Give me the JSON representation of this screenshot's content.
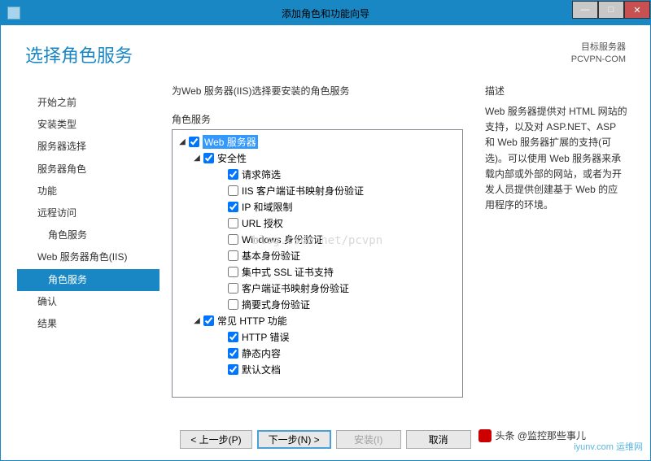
{
  "titlebar": {
    "title": "添加角色和功能向导"
  },
  "header": {
    "page_title": "选择角色服务",
    "target_label": "目标服务器",
    "target_name": "PCVPN-COM"
  },
  "sidebar": {
    "items": [
      {
        "label": "开始之前",
        "indent": 0,
        "active": false
      },
      {
        "label": "安装类型",
        "indent": 0,
        "active": false
      },
      {
        "label": "服务器选择",
        "indent": 0,
        "active": false
      },
      {
        "label": "服务器角色",
        "indent": 0,
        "active": false
      },
      {
        "label": "功能",
        "indent": 0,
        "active": false
      },
      {
        "label": "远程访问",
        "indent": 0,
        "active": false
      },
      {
        "label": "角色服务",
        "indent": 1,
        "active": false
      },
      {
        "label": "Web 服务器角色(IIS)",
        "indent": 0,
        "active": false
      },
      {
        "label": "角色服务",
        "indent": 1,
        "active": true
      },
      {
        "label": "确认",
        "indent": 0,
        "active": false
      },
      {
        "label": "结果",
        "indent": 0,
        "active": false
      }
    ]
  },
  "center": {
    "instruction": "为Web 服务器(IIS)选择要安装的角色服务",
    "section_label": "角色服务",
    "tree": [
      {
        "label": "Web 服务器",
        "indent": 0,
        "checked": true,
        "expandable": true,
        "expanded": true,
        "selected": true
      },
      {
        "label": "安全性",
        "indent": 1,
        "checked": true,
        "expandable": true,
        "expanded": true
      },
      {
        "label": "请求筛选",
        "indent": 2,
        "checked": true
      },
      {
        "label": "IIS 客户端证书映射身份验证",
        "indent": 2,
        "checked": false
      },
      {
        "label": "IP 和域限制",
        "indent": 2,
        "checked": true
      },
      {
        "label": "URL 授权",
        "indent": 2,
        "checked": false
      },
      {
        "label": "Windows 身份验证",
        "indent": 2,
        "checked": false
      },
      {
        "label": "基本身份验证",
        "indent": 2,
        "checked": false
      },
      {
        "label": "集中式 SSL 证书支持",
        "indent": 2,
        "checked": false
      },
      {
        "label": "客户端证书映射身份验证",
        "indent": 2,
        "checked": false
      },
      {
        "label": "摘要式身份验证",
        "indent": 2,
        "checked": false
      },
      {
        "label": "常见 HTTP 功能",
        "indent": 1,
        "checked": true,
        "expandable": true,
        "expanded": true
      },
      {
        "label": "HTTP 错误",
        "indent": 2,
        "checked": true
      },
      {
        "label": "静态内容",
        "indent": 2,
        "checked": true
      },
      {
        "label": "默认文档",
        "indent": 2,
        "checked": true
      }
    ]
  },
  "description": {
    "title": "描述",
    "text": "Web 服务器提供对 HTML 网站的支持，以及对 ASP.NET、ASP 和 Web 服务器扩展的支持(可选)。可以使用 Web 服务器来承载内部或外部的网站，或者为开发人员提供创建基于 Web 的应用程序的环境。"
  },
  "buttons": {
    "prev": "< 上一步(P)",
    "next": "下一步(N) >",
    "install": "安装(I)",
    "cancel": "取消"
  },
  "watermarks": {
    "source": "blog.csdn.net/pcvpn",
    "headline": "头条 @监控那些事儿",
    "logo": "iyunv.com 运维网"
  }
}
